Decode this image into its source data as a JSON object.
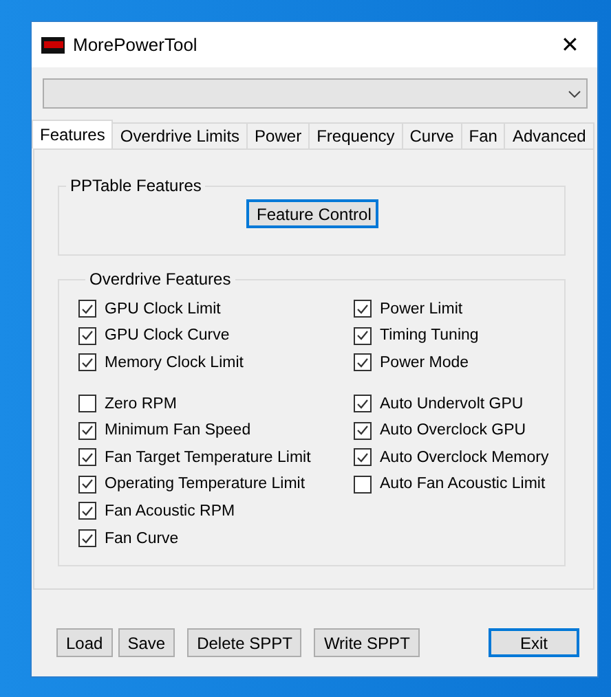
{
  "window": {
    "title": "MorePowerTool",
    "close": "✕"
  },
  "tabs": [
    {
      "label": "Features",
      "selected": true
    },
    {
      "label": "Overdrive Limits",
      "selected": false
    },
    {
      "label": "Power",
      "selected": false
    },
    {
      "label": "Frequency",
      "selected": false
    },
    {
      "label": "Curve",
      "selected": false
    },
    {
      "label": "Fan",
      "selected": false
    },
    {
      "label": "Advanced",
      "selected": false
    }
  ],
  "pptable_features": {
    "title": "PPTable Features",
    "button": {
      "label": "Feature Control",
      "default": true
    }
  },
  "overdrive_features": {
    "title": "Overdrive Features",
    "sections": [
      {
        "left": [
          {
            "label": "GPU Clock Limit",
            "checked": true
          },
          {
            "label": "GPU Clock Curve",
            "checked": true
          },
          {
            "label": "Memory Clock Limit",
            "checked": true
          }
        ],
        "right": [
          {
            "label": "Power Limit",
            "checked": true
          },
          {
            "label": "Timing Tuning",
            "checked": true
          },
          {
            "label": "Power Mode",
            "checked": true
          }
        ]
      },
      {
        "left": [
          {
            "label": "Zero RPM",
            "checked": false
          },
          {
            "label": "Minimum Fan Speed",
            "checked": true
          },
          {
            "label": "Fan Target Temperature Limit",
            "checked": true
          },
          {
            "label": "Operating Temperature Limit",
            "checked": true
          },
          {
            "label": "Fan Acoustic RPM",
            "checked": true
          },
          {
            "label": "Fan Curve",
            "checked": true
          }
        ],
        "right": [
          {
            "label": "Auto Undervolt GPU",
            "checked": true
          },
          {
            "label": "Auto Overclock GPU",
            "checked": true
          },
          {
            "label": "Auto Overclock Memory",
            "checked": true
          },
          {
            "label": "Auto Fan Acoustic Limit",
            "checked": false
          }
        ]
      }
    ]
  },
  "buttons": [
    {
      "label": "Load",
      "default": false,
      "kind": "left"
    },
    {
      "label": "Save",
      "default": false,
      "kind": "left"
    },
    {
      "label": "Delete SPPT",
      "default": false,
      "kind": "left"
    },
    {
      "label": "Write SPPT",
      "default": false,
      "kind": "left"
    },
    {
      "label": "Exit",
      "default": true,
      "kind": "right"
    }
  ]
}
